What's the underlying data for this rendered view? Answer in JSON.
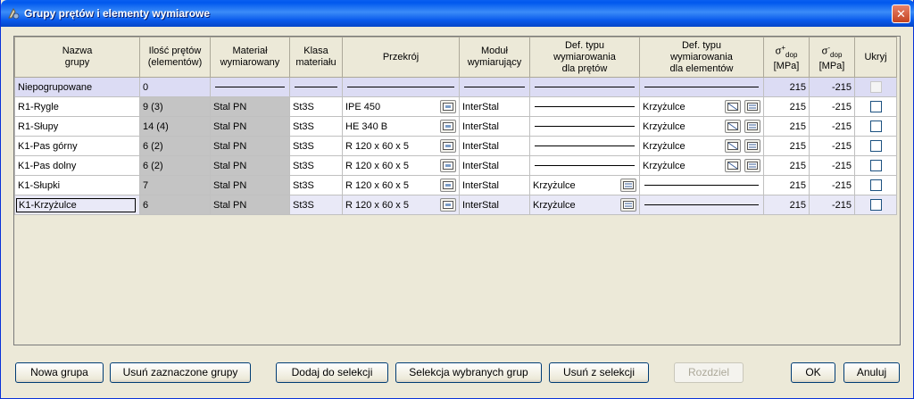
{
  "window": {
    "title": "Grupy prętów i elementy wymiarowe",
    "close_label": "✕"
  },
  "columns": {
    "nazwa": [
      "Nazwa",
      "grupy"
    ],
    "ilosc": [
      "Ilość prętów",
      "(elementów)"
    ],
    "material": [
      "Materiał",
      "wymiarowany"
    ],
    "klasa": [
      "Klasa",
      "materiału"
    ],
    "przekroj": "Przekrój",
    "modul": [
      "Moduł",
      "wymiarujący"
    ],
    "def_pretow": [
      "Def. typu",
      "wymiarowania",
      "dla prętów"
    ],
    "def_elementow": [
      "Def. typu",
      "wymiarowania",
      "dla elementów"
    ],
    "sigma_plus": {
      "symbol": "σ",
      "sup": "+",
      "sub": "dop",
      "unit": "[MPa]"
    },
    "sigma_minus": {
      "symbol": "σ",
      "sup": "-",
      "sub": "dop",
      "unit": "[MPa]"
    },
    "ukryj": "Ukryj"
  },
  "rows": [
    {
      "name": "Niepogrupowane",
      "count": "0",
      "material": "",
      "klasa": "",
      "przekroj": "",
      "modul": "",
      "def_pretow": "",
      "def_elem": "",
      "sp": "215",
      "sm": "-215"
    },
    {
      "name": "R1-Rygle",
      "count": "9 (3)",
      "material": "Stal PN",
      "klasa": "St3S",
      "przekroj": "IPE 450",
      "modul": "InterStal",
      "def_pretow": "",
      "def_elem": "Krzyżulce",
      "sp": "215",
      "sm": "-215"
    },
    {
      "name": "R1-Słupy",
      "count": "14 (4)",
      "material": "Stal PN",
      "klasa": "St3S",
      "przekroj": "HE 340 B",
      "modul": "InterStal",
      "def_pretow": "",
      "def_elem": "Krzyżulce",
      "sp": "215",
      "sm": "-215"
    },
    {
      "name": "K1-Pas górny",
      "count": "6 (2)",
      "material": "Stal PN",
      "klasa": "St3S",
      "przekroj": "R 120 x 60 x 5",
      "modul": "InterStal",
      "def_pretow": "",
      "def_elem": "Krzyżulce",
      "sp": "215",
      "sm": "-215"
    },
    {
      "name": "K1-Pas dolny",
      "count": "6 (2)",
      "material": "Stal PN",
      "klasa": "St3S",
      "przekroj": "R 120 x 60 x 5",
      "modul": "InterStal",
      "def_pretow": "",
      "def_elem": "Krzyżulce",
      "sp": "215",
      "sm": "-215"
    },
    {
      "name": "K1-Słupki",
      "count": "7",
      "material": "Stal PN",
      "klasa": "St3S",
      "przekroj": "R 120 x 60 x 5",
      "modul": "InterStal",
      "def_pretow": "Krzyżulce",
      "def_elem": "",
      "sp": "215",
      "sm": "-215"
    },
    {
      "name": "K1-Krzyżulce",
      "count": "6",
      "material": "Stal PN",
      "klasa": "St3S",
      "przekroj": "R 120 x 60 x 5",
      "modul": "InterStal",
      "def_pretow": "Krzyżulce",
      "def_elem": "",
      "sp": "215",
      "sm": "-215"
    }
  ],
  "buttons": {
    "nowa_grupa": "Nowa grupa",
    "usun_zaznaczone": "Usuń zaznaczone grupy",
    "dodaj_do_selekcji": "Dodaj do selekcji",
    "selekcja_wybranych": "Selekcja wybranych grup",
    "usun_z_selekcji": "Usuń z selekcji",
    "rozdziel": "Rozdziel",
    "ok": "OK",
    "anuluj": "Anuluj"
  },
  "colors": {
    "title_blue": "#0058ee",
    "face": "#ece9d8",
    "first_row": "#dcdcf4",
    "gray_cell": "#c4c4c4"
  }
}
